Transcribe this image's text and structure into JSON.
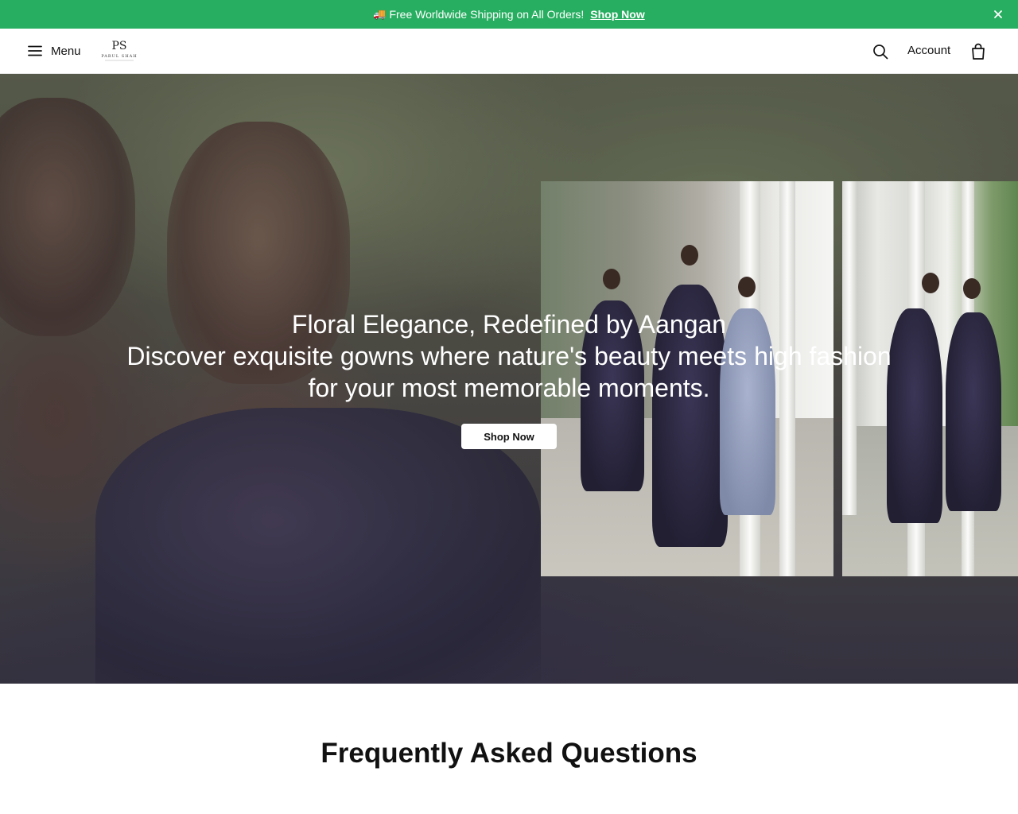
{
  "announcement": {
    "text": "Free Worldwide Shipping on All Orders!",
    "link_label": "Shop Now",
    "icons": [
      "truck-icon",
      "close-icon"
    ]
  },
  "header": {
    "menu_label": "Menu",
    "account_label": "Account",
    "logo_text": "PARUL SHAH",
    "icons": [
      "menu-icon",
      "search-icon",
      "shopping-bag-icon"
    ]
  },
  "hero": {
    "title": "Floral Elegance, Redefined by Aangan",
    "subtitle": "Discover exquisite gowns where nature's beauty meets high fashion for your most memorable moments.",
    "button_label": "Shop Now"
  },
  "faq": {
    "title": "Frequently Asked Questions"
  },
  "colors": {
    "announcement_bg": "#27ae60",
    "header_bg": "#ffffff",
    "button_bg": "#ffffff",
    "text_dark": "#111111"
  }
}
